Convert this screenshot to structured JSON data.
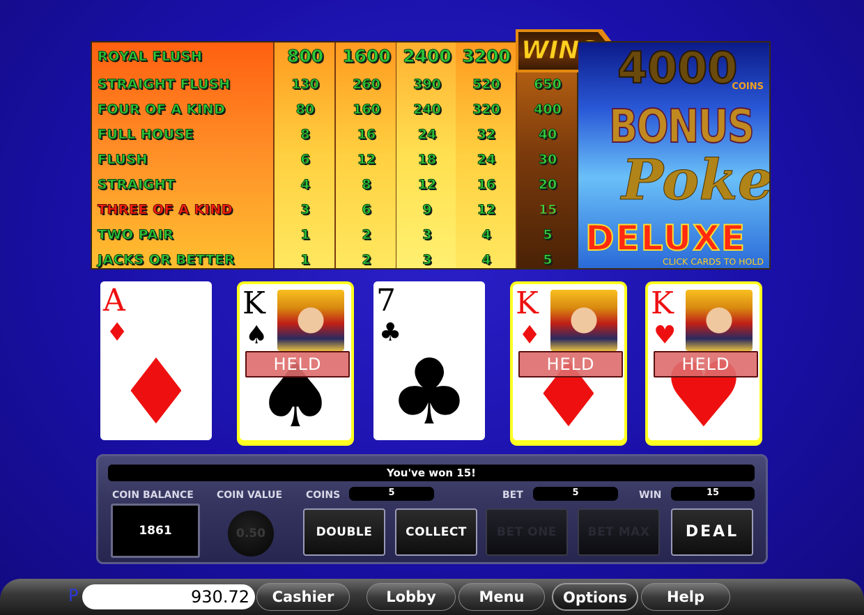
{
  "paytable": {
    "rows": [
      {
        "hand": "ROYAL FLUSH",
        "pays": [
          "800",
          "1600",
          "2400",
          "3200"
        ],
        "win": ""
      },
      {
        "hand": "STRAIGHT FLUSH",
        "pays": [
          "130",
          "260",
          "390",
          "520"
        ],
        "win": "650"
      },
      {
        "hand": "FOUR OF A KIND",
        "pays": [
          "80",
          "160",
          "240",
          "320"
        ],
        "win": "400"
      },
      {
        "hand": "FULL HOUSE",
        "pays": [
          "8",
          "16",
          "24",
          "32"
        ],
        "win": "40"
      },
      {
        "hand": "FLUSH",
        "pays": [
          "6",
          "12",
          "18",
          "24"
        ],
        "win": "30"
      },
      {
        "hand": "STRAIGHT",
        "pays": [
          "4",
          "8",
          "12",
          "16"
        ],
        "win": "20"
      },
      {
        "hand": "THREE OF A KIND",
        "pays": [
          "3",
          "6",
          "9",
          "12"
        ],
        "win": "15"
      },
      {
        "hand": "TWO PAIR",
        "pays": [
          "1",
          "2",
          "3",
          "4"
        ],
        "win": "5"
      },
      {
        "hand": "JACKS OR BETTER",
        "pays": [
          "1",
          "2",
          "3",
          "4"
        ],
        "win": "5"
      }
    ],
    "highlighted_row": 6,
    "wins_label": "WINS",
    "jackpot_value": "4000",
    "jackpot_unit": "COINS",
    "colors": {
      "hand_text": "#2ec83a",
      "highlight_hand": "#ff2010",
      "highlight_win": "#ffe020"
    }
  },
  "logo": {
    "line1": "BONUS",
    "line2": "Poker",
    "line3": "DELUXE",
    "hint": "CLICK CARDS TO HOLD"
  },
  "cards": [
    {
      "rank": "A",
      "suit": "♦",
      "color": "red",
      "held": false,
      "face": false
    },
    {
      "rank": "K",
      "suit": "♠",
      "color": "black",
      "held": true,
      "face": true
    },
    {
      "rank": "7",
      "suit": "♣",
      "color": "black",
      "held": false,
      "face": false
    },
    {
      "rank": "K",
      "suit": "♦",
      "color": "red",
      "held": true,
      "face": true
    },
    {
      "rank": "K",
      "suit": "♥",
      "color": "red",
      "held": true,
      "face": true
    }
  ],
  "held_label": "HELD",
  "panel": {
    "message": "You've won 15!",
    "coin_balance_label": "COIN BALANCE",
    "coin_balance": "1861",
    "coin_value_label": "COIN VALUE",
    "coin_value": "0.50",
    "coins_label": "COINS",
    "coins": "5",
    "bet_label": "BET",
    "bet": "5",
    "win_label": "WIN",
    "win": "15",
    "buttons": {
      "double": "DOUBLE",
      "collect": "COLLECT",
      "bet_one": "BET ONE",
      "bet_max": "BET MAX",
      "deal": "DEAL"
    }
  },
  "bottombar": {
    "prefix": "P",
    "money": "930.72",
    "cashier": "Cashier",
    "lobby": "Lobby",
    "menu": "Menu",
    "options": "Options",
    "help": "Help"
  }
}
